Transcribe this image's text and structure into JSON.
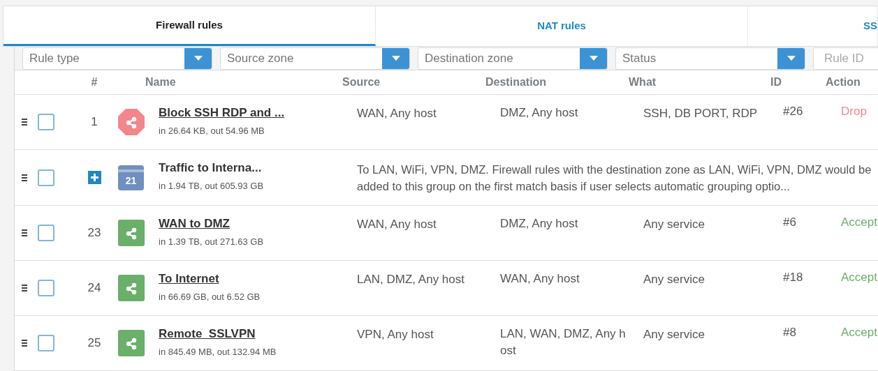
{
  "tabs": [
    {
      "label": "Firewall rules",
      "selected": true
    },
    {
      "label": "NAT rules",
      "selected": false
    },
    {
      "label": "SS",
      "selected": false
    }
  ],
  "filters": [
    {
      "kind": "select",
      "placeholder": "Rule type"
    },
    {
      "kind": "select",
      "placeholder": "Source zone"
    },
    {
      "kind": "select",
      "placeholder": "Destination zone"
    },
    {
      "kind": "select",
      "placeholder": "Status"
    },
    {
      "kind": "input",
      "placeholder": "Rule ID"
    }
  ],
  "table": {
    "columns": [
      "#",
      "Name",
      "Source",
      "Destination",
      "What",
      "ID",
      "Action"
    ],
    "rows": [
      {
        "kind": "rule",
        "checked": false,
        "number": "1",
        "name": "Block SSH RDP and ...",
        "traffic": "in 26.64 KB, out 54.96 MB",
        "source": "WAN, Any host",
        "destination": "DMZ, Any host",
        "what": "SSH, DB PORT, RDP",
        "id": "#26",
        "action": "Drop",
        "color": "#f4858a"
      },
      {
        "kind": "group",
        "checked": false,
        "expanded": false,
        "count": "21",
        "name": "Traffic to Interna...",
        "traffic": "in 1.94 TB, out 605.93 GB",
        "description": "To LAN, WiFi, VPN, DMZ. Firewall rules with the destination zone as LAN, WiFi, VPN, DMZ would be added to this group on the first match basis if user selects automatic grouping optio..."
      },
      {
        "kind": "rule",
        "checked": false,
        "number": "23",
        "name": "WAN to DMZ",
        "traffic": "in 1.39 TB, out 271.63 GB",
        "source": "WAN, Any host",
        "destination": "DMZ, Any host",
        "what": "Any service",
        "id": "#6",
        "action": "Accept",
        "color": "#6aaf6a"
      },
      {
        "kind": "rule",
        "checked": false,
        "number": "24",
        "name": "To Internet",
        "traffic": "in 66.69 GB, out 6.52 GB",
        "source": "LAN, DMZ, Any host",
        "destination": "WAN, Any host",
        "what": "Any service",
        "id": "#18",
        "action": "Accept",
        "color": "#6aaf6a"
      },
      {
        "kind": "rule",
        "checked": false,
        "number": "25",
        "name": "Remote_SSLVPN",
        "traffic": "in 845.49 MB, out 132.94 MB",
        "source": "VPN, Any host",
        "destination": "LAN, WAN, DMZ, Any host",
        "what": "Any service",
        "id": "#8",
        "action": "Accept",
        "color": "#6aaf6a"
      }
    ]
  }
}
